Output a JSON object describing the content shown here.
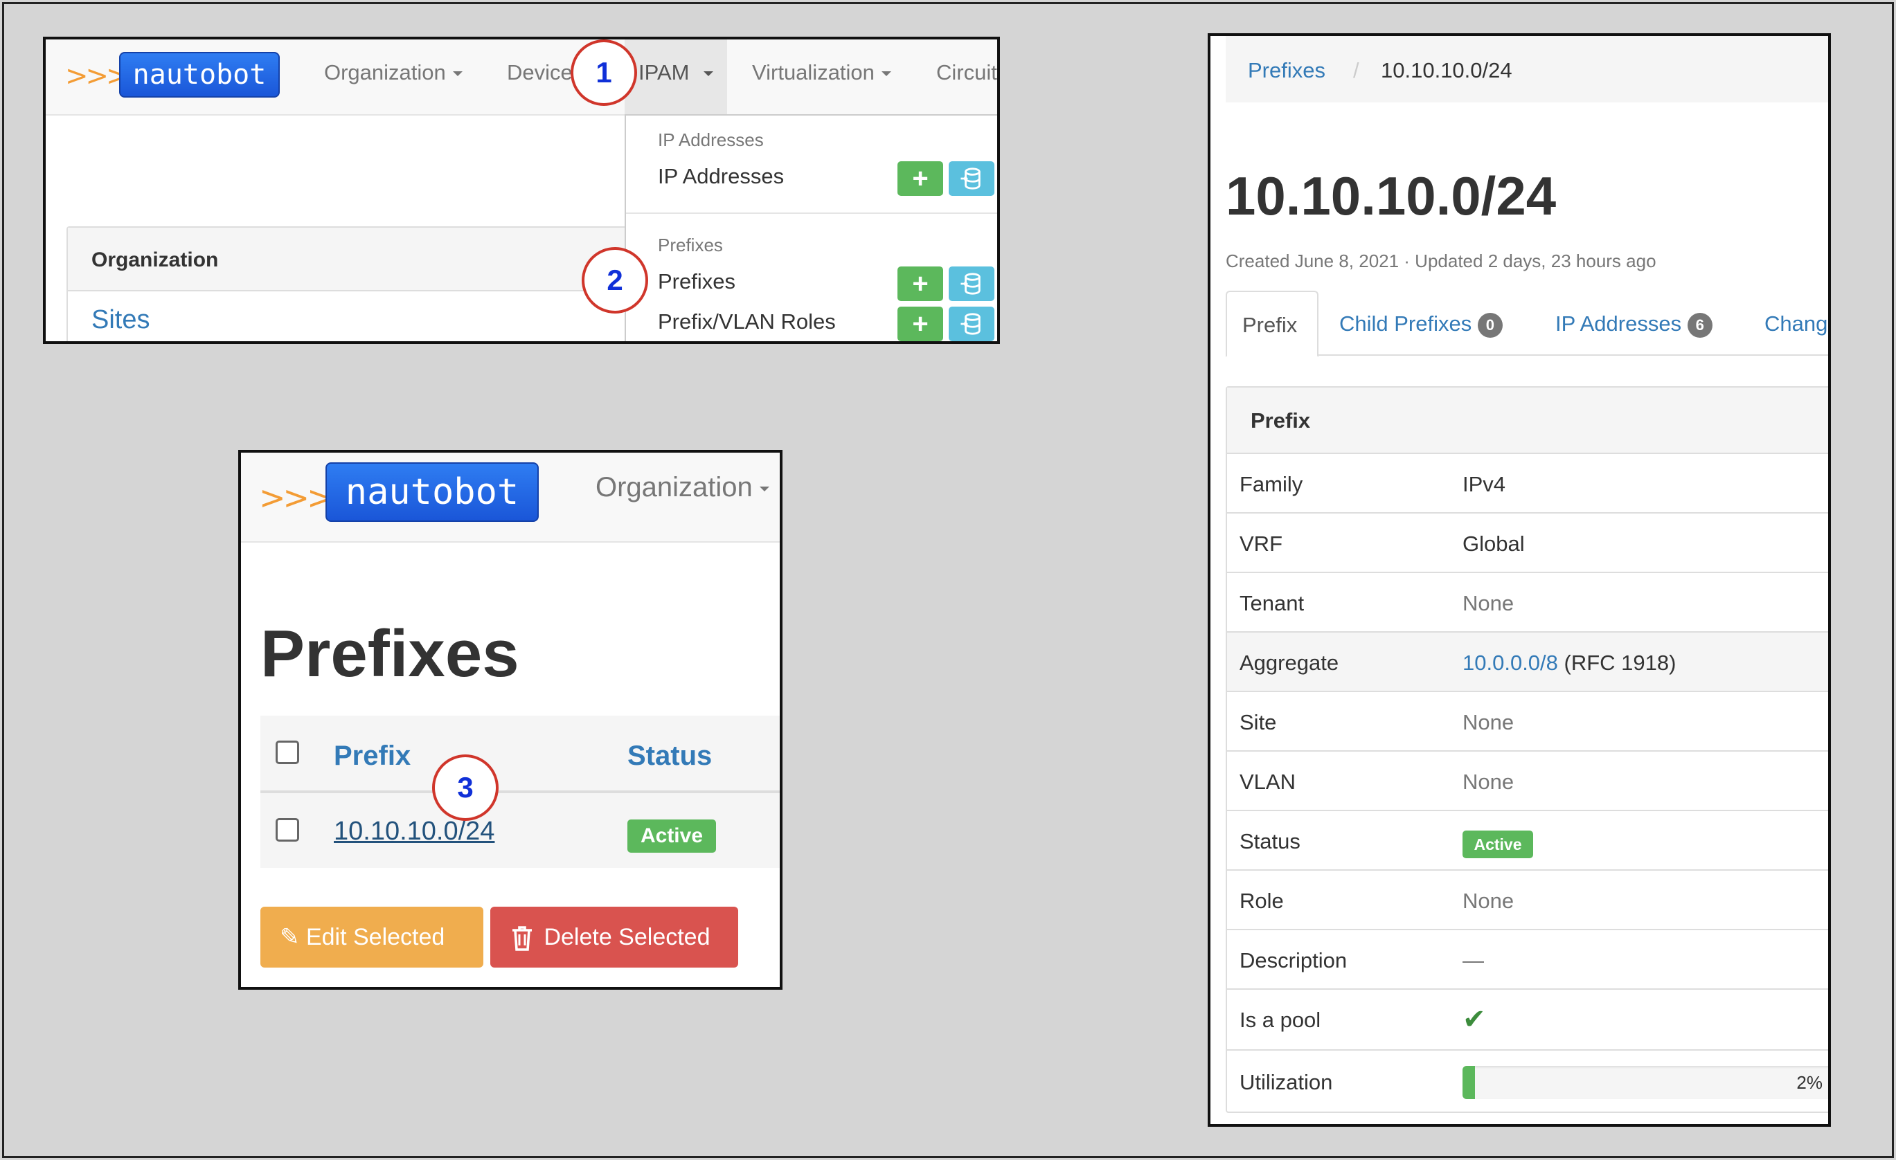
{
  "panel1": {
    "logo": {
      "arrows": ">>>",
      "text": "nautobot"
    },
    "nav": [
      "Organization",
      "Device",
      "IPAM",
      "Virtualization",
      "Circuit"
    ],
    "dropdown": {
      "section1_header": "IP Addresses",
      "section1_item": "IP Addresses",
      "section2_header": "Prefixes",
      "section2_items": [
        "Prefixes",
        "Prefix/VLAN Roles"
      ]
    },
    "sidebar": {
      "heading": "Organization",
      "link": "Sites"
    },
    "step1": "1",
    "step2": "2"
  },
  "panel2": {
    "logo": {
      "arrows": ">>>",
      "text": "nautobot"
    },
    "nav_org": "Organization",
    "title": "Prefixes",
    "col_prefix": "Prefix",
    "col_status": "Status",
    "row_prefix": "10.10.10.0/24",
    "row_status": "Active",
    "edit_btn": "Edit Selected",
    "delete_btn": "Delete Selected",
    "step3": "3"
  },
  "panel3": {
    "breadcrumb_root": "Prefixes",
    "breadcrumb_sep": "/",
    "breadcrumb_current": "10.10.10.0/24",
    "title": "10.10.10.0/24",
    "meta": "Created June 8, 2021 · Updated 2 days, 23 hours ago",
    "tabs": {
      "prefix": "Prefix",
      "child": "Child Prefixes",
      "child_count": "0",
      "ip": "IP Addresses",
      "ip_count": "6",
      "changelog": "Chang"
    },
    "section_heading": "Prefix",
    "rows": {
      "family": {
        "k": "Family",
        "v": "IPv4"
      },
      "vrf": {
        "k": "VRF",
        "v": "Global"
      },
      "tenant": {
        "k": "Tenant",
        "v": "None"
      },
      "aggregate": {
        "k": "Aggregate",
        "v_link": "10.0.0.0/8",
        "v_rest": "(RFC 1918)"
      },
      "site": {
        "k": "Site",
        "v": "None"
      },
      "vlan": {
        "k": "VLAN",
        "v": "None"
      },
      "status": {
        "k": "Status",
        "v": "Active"
      },
      "role": {
        "k": "Role",
        "v": "None"
      },
      "description": {
        "k": "Description",
        "v": "—"
      },
      "pool": {
        "k": "Is a pool",
        "v": "✔"
      },
      "utilization": {
        "k": "Utilization",
        "v": "2%",
        "fraction": 0.02
      }
    }
  },
  "colors": {
    "green": "#5cb85c",
    "info": "#5bc0de",
    "link": "#337ab7",
    "warning": "#f0ad4e",
    "danger": "#d9534f",
    "step_circle": "#d0362b"
  }
}
